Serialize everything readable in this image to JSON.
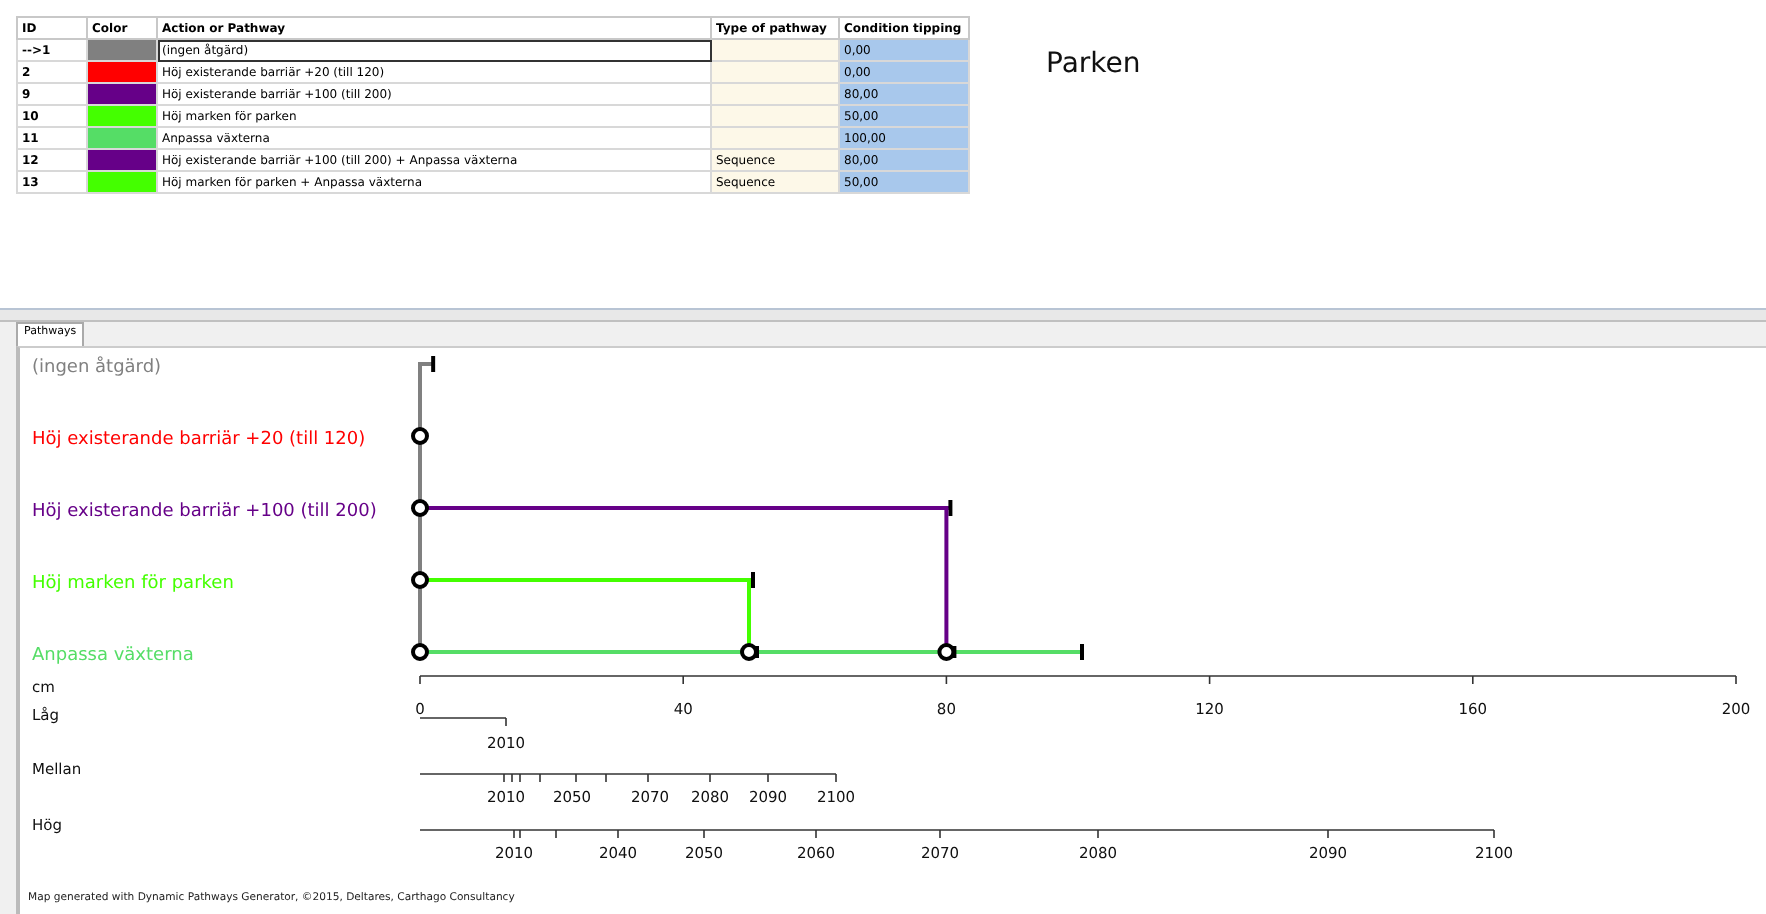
{
  "table": {
    "columns": [
      "ID",
      "Color",
      "Action or Pathway",
      "Type of pathway",
      "Condition tipping"
    ],
    "rows": [
      {
        "id": "-->1",
        "color": "#808080",
        "action": "(ingen åtgärd)",
        "type": "",
        "tipping": "0,00",
        "focused": true
      },
      {
        "id": "2",
        "color": "#ff0000",
        "action": "Höj existerande barriär +20 (till 120)",
        "type": "",
        "tipping": "0,00",
        "focused": false
      },
      {
        "id": "9",
        "color": "#660088",
        "action": "Höj existerande barriär +100 (till 200)",
        "type": "",
        "tipping": "80,00",
        "focused": false
      },
      {
        "id": "10",
        "color": "#44ff00",
        "action": "Höj marken för parken",
        "type": "",
        "tipping": "50,00",
        "focused": false
      },
      {
        "id": "11",
        "color": "#55dd66",
        "action": "Anpassa växterna",
        "type": "",
        "tipping": "100,00",
        "focused": false
      },
      {
        "id": "12",
        "color": "#660088",
        "action": "Höj existerande barriär +100 (till 200) + Anpassa växterna",
        "type": "Sequence",
        "tipping": "80,00",
        "focused": false
      },
      {
        "id": "13",
        "color": "#44ff00",
        "action": "Höj marken för parken + Anpassa växterna",
        "type": "Sequence",
        "tipping": "50,00",
        "focused": false
      }
    ]
  },
  "title": "Parken",
  "tabs": [
    {
      "label": "Pathways",
      "selected": true
    }
  ],
  "diagram": {
    "pathways": [
      {
        "label": "(ingen åtgärd)",
        "kind": "none"
      },
      {
        "label": "Höj existerande barriär +20 (till 120)",
        "kind": "action"
      },
      {
        "label": "Höj existerande barriär +100 (till 200)",
        "kind": "action"
      },
      {
        "label": "Höj marken för parken",
        "kind": "action"
      },
      {
        "label": "Anpassa växterna",
        "kind": "action"
      }
    ],
    "axis": {
      "unit": "cm",
      "ticks": [
        "0",
        "40",
        "80",
        "120",
        "160",
        "200"
      ]
    },
    "timelines": [
      {
        "label": "Låg",
        "tick_labels": [
          "2010"
        ]
      },
      {
        "label": "Mellan",
        "tick_labels": [
          "2010",
          "2050",
          "2070",
          "2080",
          "2090",
          "2100"
        ]
      },
      {
        "label": "Hög",
        "tick_labels": [
          "2010",
          "2040",
          "2050",
          "2060",
          "2070",
          "2080",
          "2090",
          "2100"
        ]
      }
    ]
  },
  "footer": "Map generated with Dynamic Pathways Generator, ©2015, Deltares, Carthago Consultancy"
}
